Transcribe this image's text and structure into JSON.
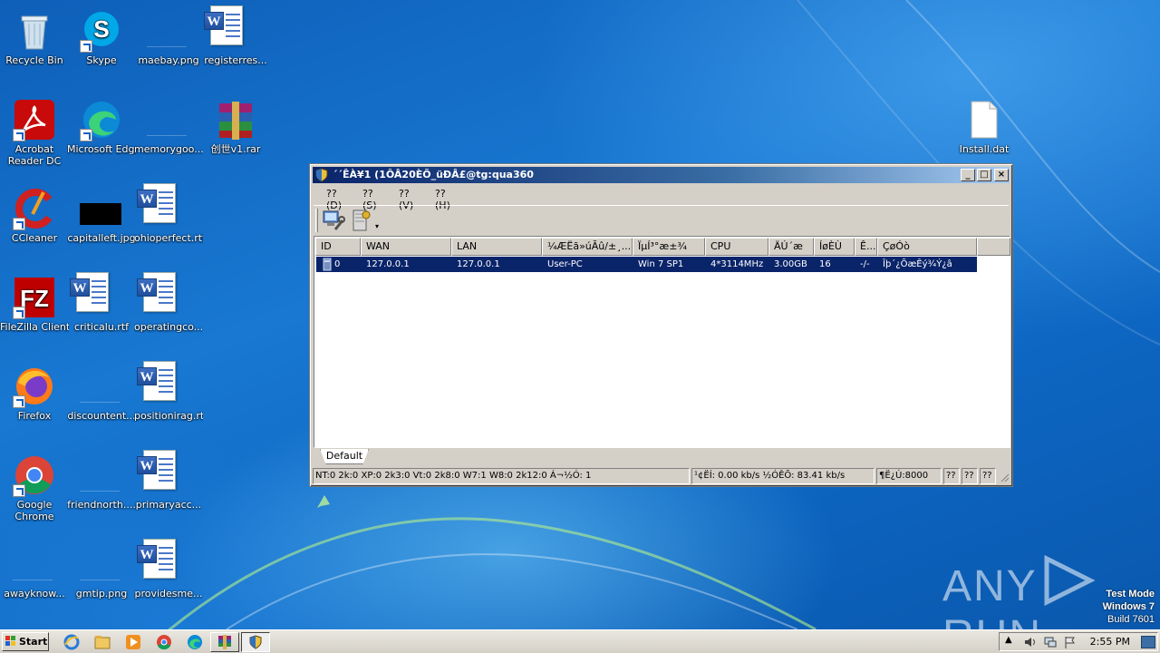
{
  "desktop": {
    "icons": [
      {
        "label": "Recycle Bin"
      },
      {
        "label": "Skype"
      },
      {
        "label": "maebay.png"
      },
      {
        "label": "registerres..."
      },
      {
        "label": "Acrobat Reader DC"
      },
      {
        "label": "Microsoft Edge"
      },
      {
        "label": "memorygoo..."
      },
      {
        "label": "创世v1.rar"
      },
      {
        "label": "Install.dat"
      },
      {
        "label": "CCleaner"
      },
      {
        "label": "capitalleft.jpg"
      },
      {
        "label": "ohioperfect.rtf"
      },
      {
        "label": "FileZilla Client"
      },
      {
        "label": "criticalu.rtf"
      },
      {
        "label": "operatingco..."
      },
      {
        "label": "Firefox"
      },
      {
        "label": "discountent..."
      },
      {
        "label": "positionirag.rtf"
      },
      {
        "label": "Google Chrome"
      },
      {
        "label": "friendnorth...."
      },
      {
        "label": "primaryacc..."
      },
      {
        "label": "awayknow..."
      },
      {
        "label": "gmtip.png"
      },
      {
        "label": "providesme..."
      }
    ]
  },
  "window": {
    "title": "´´ÊÀ¥1 (1ÔÂ20ÈÕ_üÐÂ£@tg:qua360",
    "controls": {
      "minimize": "_",
      "maximize": "□",
      "close": "×"
    },
    "menu": [
      "??(D)",
      "??(S)",
      "??(V)",
      "??(H)"
    ],
    "columns": [
      "ID",
      "WAN",
      "LAN",
      "¼ÆËã»úÃû/±¸...",
      "ÏµÍ³°æ±¾",
      "CPU",
      "ÄÚ´æ",
      "ÍøÈÙ",
      "Ê...",
      "ÇøÓò"
    ],
    "rows": [
      {
        "id": "0",
        "wan": "127.0.0.1",
        "lan": "127.0.0.1",
        "computer": "User-PC",
        "os": "Win 7 SP1",
        "cpu": "4*3114MHz",
        "memory": "3.00GB",
        "net": "16",
        "cam": "-/-",
        "region": "Îþ´¿ÕæÊý¾Ý¿â"
      }
    ],
    "tab": "Default",
    "status": {
      "os_counts": "NT:0 2k:0 XP:0 2k3:0 Vt:0 2k8:0 W7:1 W8:0 2k12:0  Á¬½Ó: 1",
      "speed": "¹¢ËÍ: 0.00 kb/s ½ÓÊÕ: 83.41 kb/s",
      "port": "¶Ë¿Ú:8000",
      "extra": [
        "??",
        "??",
        "??"
      ]
    }
  },
  "watermark": {
    "brand": "ANY",
    "brand2": "RUN",
    "mode": "Test Mode",
    "os": "Windows 7",
    "build": "Build 7601"
  },
  "taskbar": {
    "start": "Start",
    "clock": "2:55 PM"
  }
}
